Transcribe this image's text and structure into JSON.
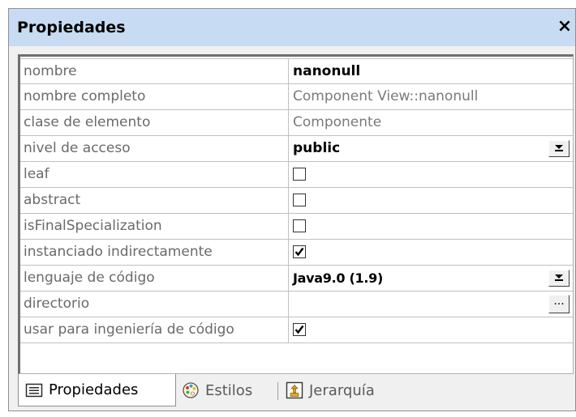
{
  "panel": {
    "title": "Propiedades",
    "close_label": "×"
  },
  "properties": [
    {
      "name": "nombre",
      "value": "nanonull",
      "kind": "text-bold"
    },
    {
      "name": "nombre completo",
      "value": "Component View::nanonull",
      "kind": "text-grey"
    },
    {
      "name": "clase de elemento",
      "value": "Componente",
      "kind": "text-grey"
    },
    {
      "name": "nivel de acceso",
      "value": "public",
      "kind": "dropdown"
    },
    {
      "name": "leaf",
      "checked": false,
      "kind": "checkbox"
    },
    {
      "name": "abstract",
      "checked": false,
      "kind": "checkbox"
    },
    {
      "name": "isFinalSpecialization",
      "checked": false,
      "kind": "checkbox"
    },
    {
      "name": "instanciado indirectamente",
      "checked": true,
      "kind": "checkbox"
    },
    {
      "name": "lenguaje de código",
      "value": "Java9.0 (1.9)",
      "kind": "dropdown"
    },
    {
      "name": "directorio",
      "value": "",
      "kind": "ellipsis"
    },
    {
      "name": "usar para ingeniería de código",
      "checked": true,
      "kind": "checkbox"
    }
  ],
  "ellipsis_label": "...",
  "tabs": [
    {
      "label": "Propiedades",
      "icon": "list-icon",
      "active": true
    },
    {
      "label": "Estilos",
      "icon": "palette-icon",
      "active": false
    },
    {
      "label": "Jerarquía",
      "icon": "hierarchy-icon",
      "active": false
    }
  ],
  "colors": {
    "title_bar": "#c7dcf2",
    "window_bg": "#f0f0f0",
    "grid_line": "#c0c0c0",
    "label_text": "#6a6a6a"
  }
}
